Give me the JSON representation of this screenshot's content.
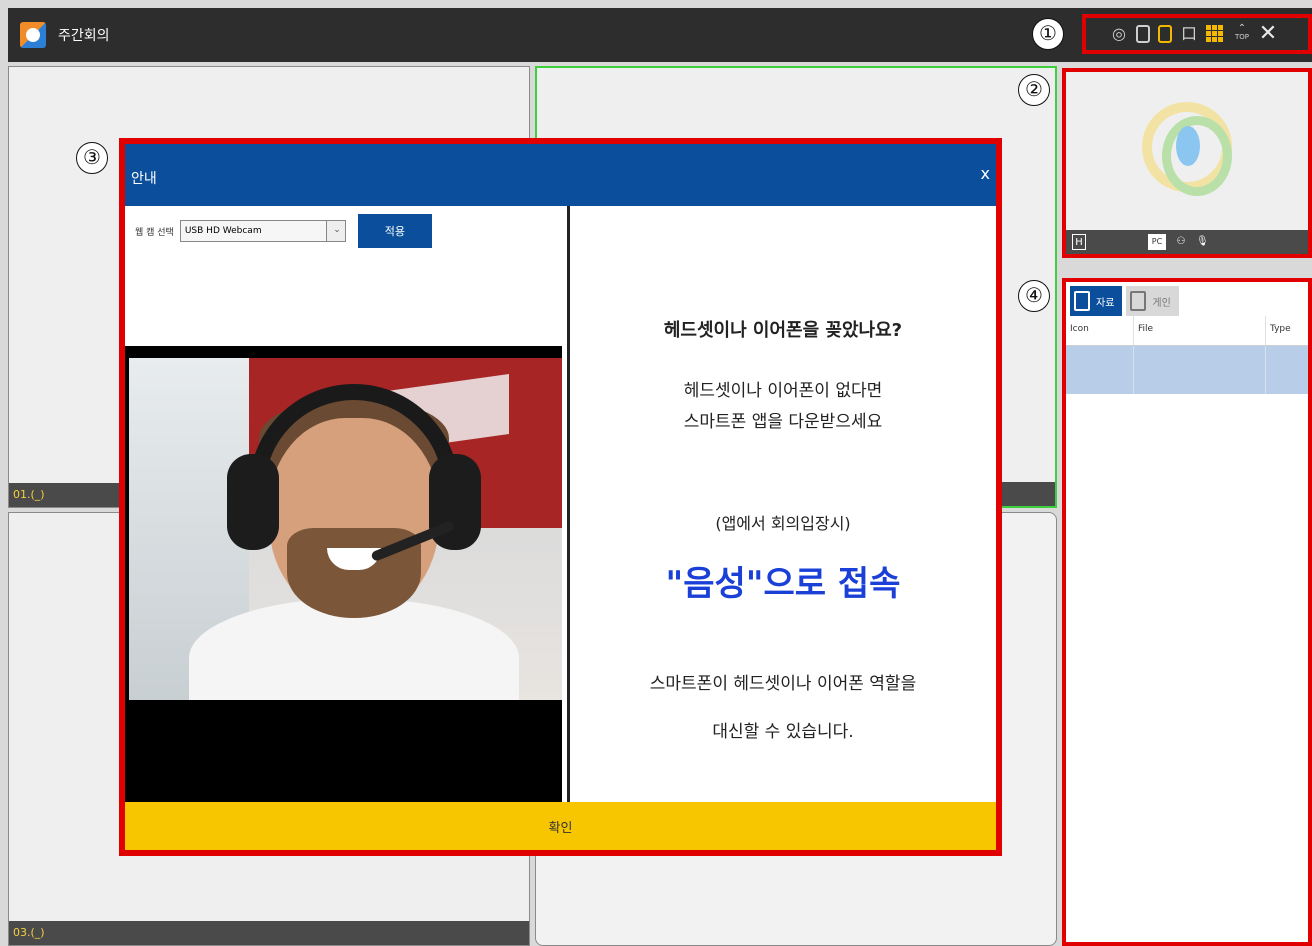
{
  "window": {
    "title": "주간회의",
    "icons": [
      "app-logo-icon",
      "refresh-icon",
      "layout-single-icon",
      "layout-dual-icon",
      "chat-icon",
      "grid-icon",
      "top-icon",
      "close-icon"
    ],
    "top_label": "TOP"
  },
  "annotations": [
    "①",
    "②",
    "③",
    "④"
  ],
  "panels": {
    "p1_label": "01.(_)",
    "p3_label": "03.(_)"
  },
  "preview": {
    "h_label": "H",
    "pc_label": "PC"
  },
  "files": {
    "tabs": [
      {
        "label": "자료",
        "active": true
      },
      {
        "label": "게인",
        "active": false
      }
    ],
    "columns": [
      "Icon",
      "File",
      "Type"
    ]
  },
  "dialog": {
    "title": "안내",
    "close": "x",
    "webcam_label": "웹 캠 선택",
    "webcam_value": "USB HD Webcam",
    "apply_label": "적용",
    "question": "헤드셋이나 이어폰을 꽂았나요?",
    "line1": "헤드셋이나 이어폰이 없다면",
    "line2": "스마트폰 앱을 다운받으세요",
    "paren": "(앱에서 회의입장시)",
    "emphasis": "\"음성\"으로 접속",
    "line3": "스마트폰이 헤드셋이나 이어폰 역할을",
    "line4": "대신할 수 있습니다.",
    "confirm_label": "확인"
  },
  "colors": {
    "accent_blue": "#0b4f9c",
    "annotation_red": "#e00000",
    "confirm_yellow": "#f7c600",
    "emphasis_blue": "#1a40d8",
    "active_green": "#3cd13c"
  }
}
